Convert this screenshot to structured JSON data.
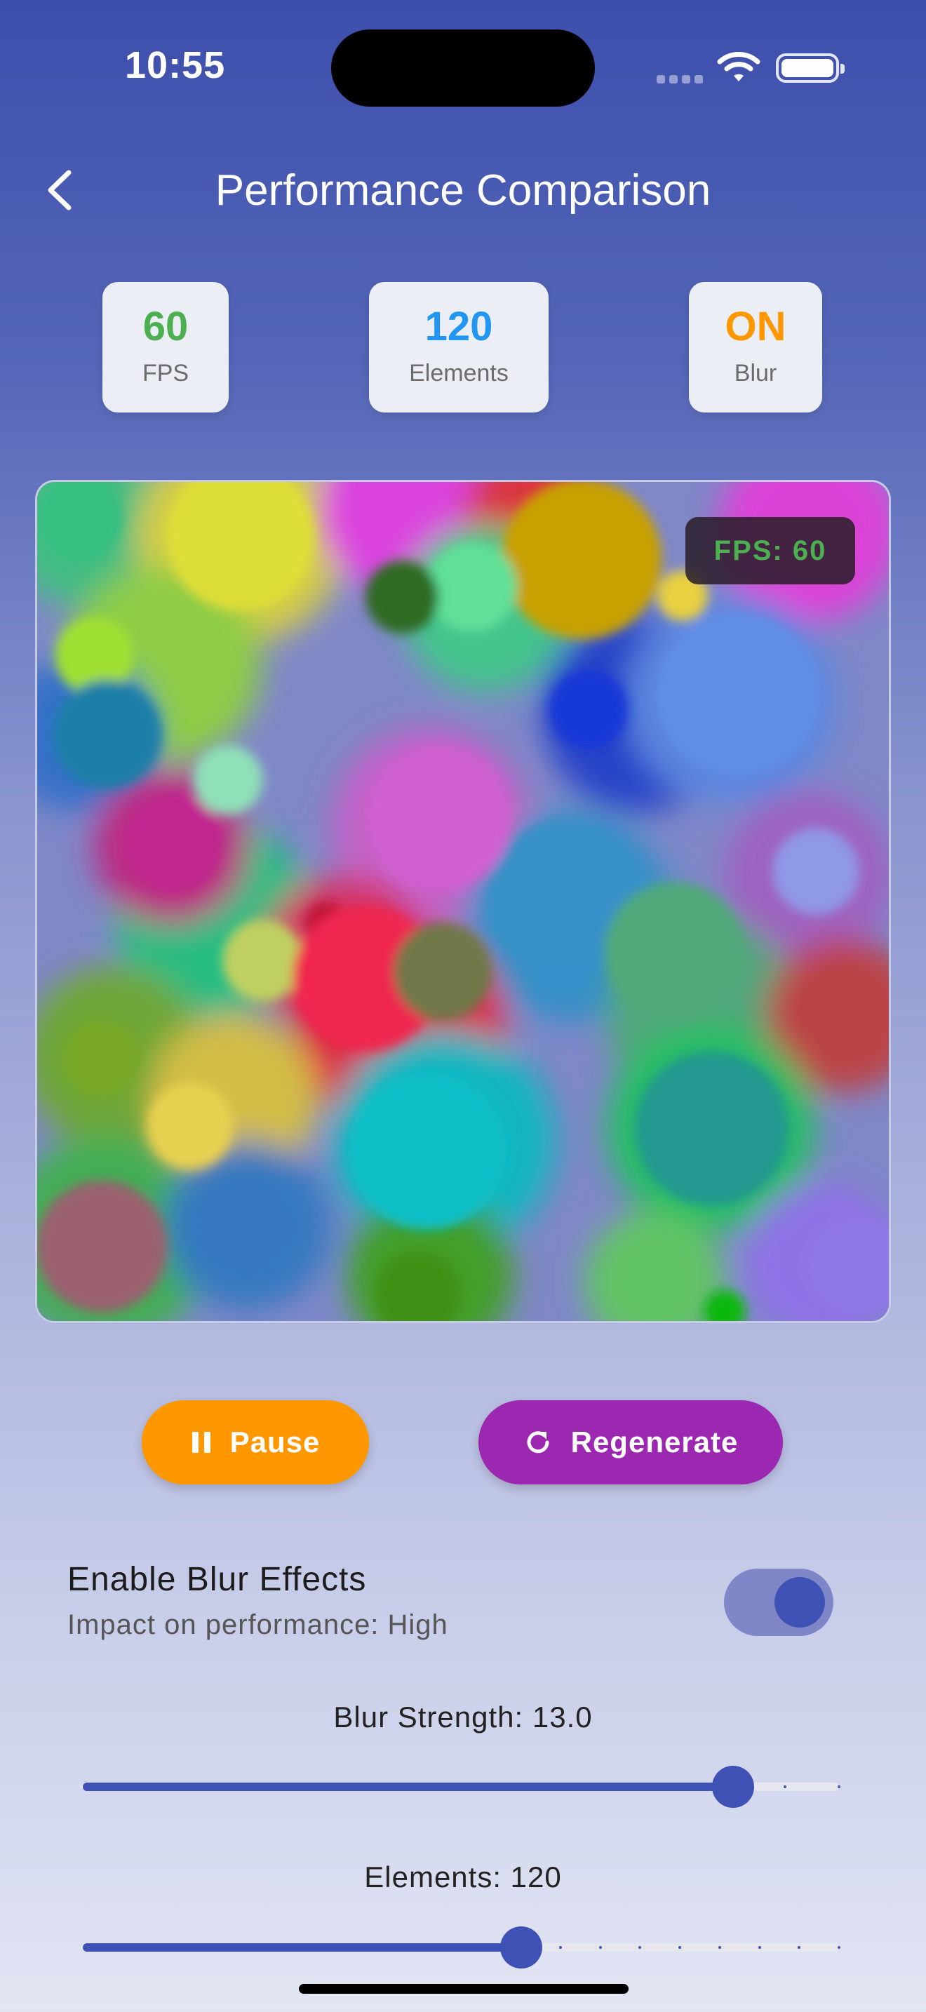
{
  "status_bar": {
    "time": "10:55"
  },
  "header": {
    "title": "Performance Comparison"
  },
  "stats": [
    {
      "value": "60",
      "label": "FPS",
      "color": "#4caf50"
    },
    {
      "value": "120",
      "label": "Elements",
      "color": "#2196f3"
    },
    {
      "value": "ON",
      "label": "Blur",
      "color": "#ff9800"
    }
  ],
  "canvas": {
    "fps_badge": "FPS: 60"
  },
  "buttons": {
    "pause_label": "Pause",
    "regenerate_label": "Regenerate"
  },
  "blur_toggle": {
    "title": "Enable Blur Effects",
    "subtitle": "Impact on performance: High",
    "enabled": true
  },
  "sliders": {
    "blur": {
      "label": "Blur Strength: 13.0",
      "fraction": 0.86
    },
    "elements": {
      "label": "Elements: 120",
      "fraction": 0.58
    }
  },
  "colors": {
    "accent": "#3f51b5",
    "pause": "#ff9800",
    "regenerate": "#9c27b0"
  }
}
